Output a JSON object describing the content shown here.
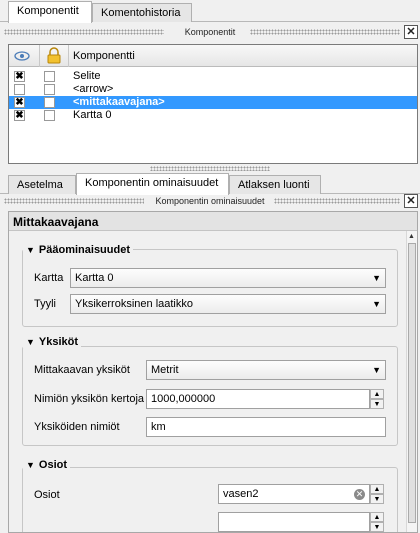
{
  "top_tabs": [
    {
      "label": "Komponentit",
      "active": true
    },
    {
      "label": "Komentohistoria",
      "active": false
    }
  ],
  "items_dock": {
    "title": "Komponentit",
    "close": "✕"
  },
  "items_list": {
    "header": {
      "visible_icon": "eye-icon",
      "lock_icon": "lock-icon",
      "column_label": "Komponentti"
    },
    "rows": [
      {
        "visible": true,
        "locked": false,
        "label": "Selite",
        "selected": false
      },
      {
        "visible": false,
        "locked": false,
        "label": "<arrow>",
        "selected": false
      },
      {
        "visible": true,
        "locked": false,
        "label": "<mittakaavajana>",
        "selected": true
      },
      {
        "visible": true,
        "locked": false,
        "label": "Kartta 0",
        "selected": false
      }
    ]
  },
  "bottom_tabs": [
    {
      "label": "Asetelma",
      "active": false
    },
    {
      "label": "Komponentin ominaisuudet",
      "active": true
    },
    {
      "label": "Atlaksen luonti",
      "active": false
    }
  ],
  "props_dock": {
    "title": "Komponentin ominaisuudet",
    "close": "✕"
  },
  "props": {
    "title": "Mittakaavajana",
    "main_group": {
      "title": "Pääominaisuudet",
      "map_label": "Kartta",
      "map_value": "Kartta 0",
      "style_label": "Tyyli",
      "style_value": "Yksikerroksinen laatikko"
    },
    "units_group": {
      "title": "Yksiköt",
      "units_label": "Mittakaavan yksiköt",
      "units_value": "Metrit",
      "multiplier_label": "Nimiön yksikön kertoja",
      "multiplier_value": "1000,000000",
      "unit_name_label": "Yksiköiden nimiöt",
      "unit_name_value": "km"
    },
    "segments_group": {
      "title": "Osiot",
      "segments_label": "Osiot",
      "segments_value": "vasen2"
    }
  },
  "glyphs": {
    "check": "✖",
    "dropdown": "▼",
    "up": "▲",
    "down": "▼",
    "collapse": "▼",
    "clear": "✕"
  }
}
